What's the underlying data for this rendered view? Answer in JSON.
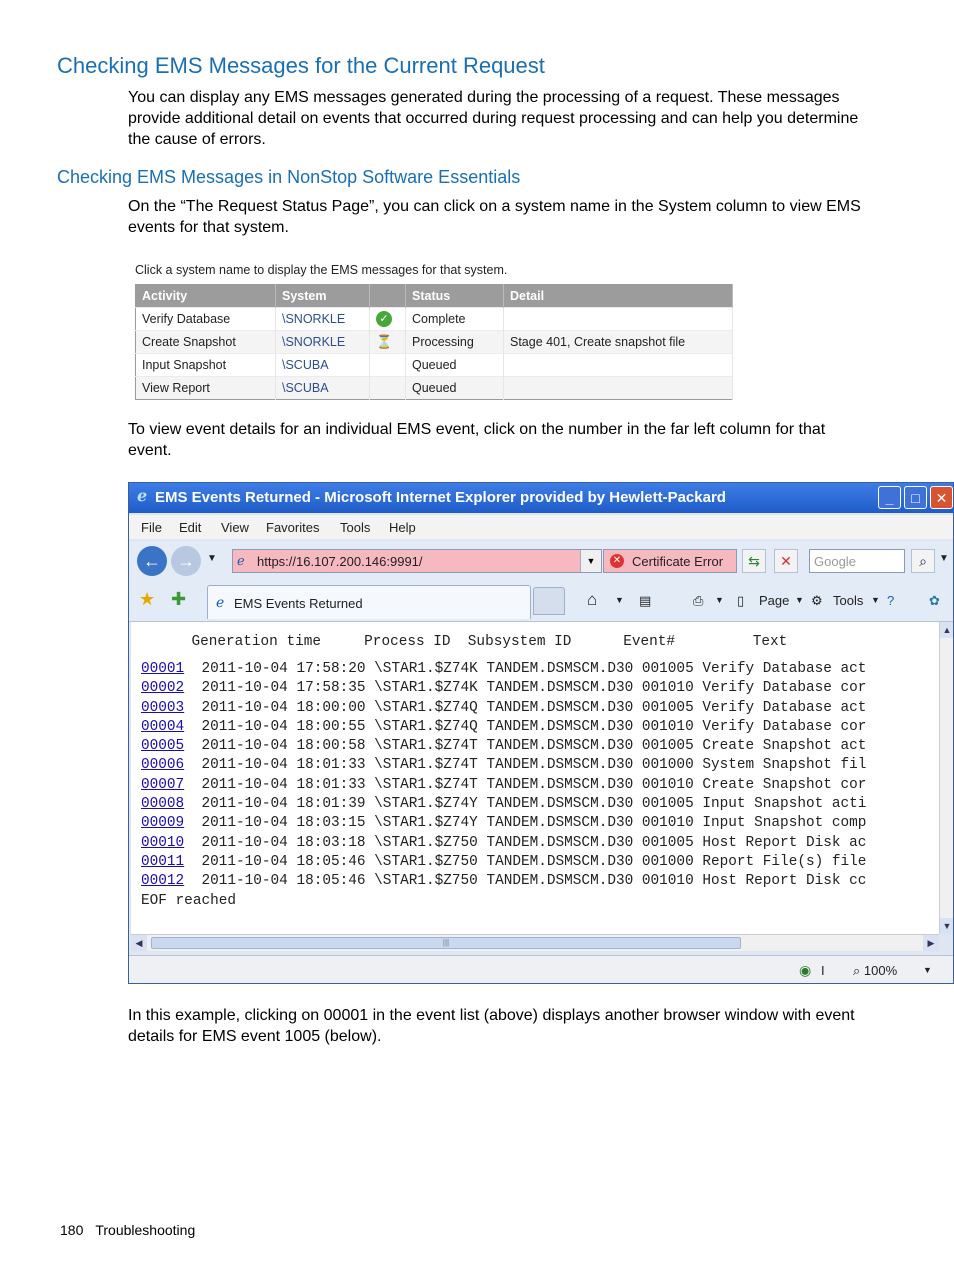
{
  "heading1": "Checking EMS Messages for the Current Request",
  "para1": "You can display any EMS messages generated during the processing of a request. These messages provide additional detail on events that occurred during request processing and can help you determine the cause of errors.",
  "heading2": "Checking EMS Messages in NonStop Software Essentials",
  "para2": "On the “The Request Status Page”, you can click on a system name in the System column to view EMS events for that system.",
  "fig1": {
    "caption": "Click a system name to display the EMS messages for that system.",
    "headers": [
      "Activity",
      "System",
      "",
      "Status",
      "Detail"
    ],
    "rows": [
      {
        "activity": "Verify Database",
        "system": "\\SNORKLE",
        "icon": "check-icon",
        "status": "Complete",
        "detail": ""
      },
      {
        "activity": "Create Snapshot",
        "system": "\\SNORKLE",
        "icon": "hourglass-icon",
        "status": "Processing",
        "detail": "Stage 401, Create snapshot file"
      },
      {
        "activity": "Input Snapshot",
        "system": "\\SCUBA",
        "icon": "",
        "status": "Queued",
        "detail": ""
      },
      {
        "activity": "View Report",
        "system": "\\SCUBA",
        "icon": "",
        "status": "Queued",
        "detail": ""
      }
    ]
  },
  "para3": "To view event details for an individual EMS event, click on the number in the far left column for that event.",
  "browser": {
    "title": "EMS Events Returned - Microsoft Internet Explorer provided by Hewlett-Packard",
    "menu": [
      "File",
      "Edit",
      "View",
      "Favorites",
      "Tools",
      "Help"
    ],
    "url": "https://16.107.200.146:9991/",
    "cert_error": "Certificate Error",
    "search_placeholder": "Google",
    "tab_title": "EMS Events Returned",
    "tools": {
      "page": "Page",
      "tools": "Tools"
    },
    "zoom": "100%",
    "status_zone": "I",
    "columns_header": "       Generation time     Process ID  Subsystem ID      Event#         Text",
    "events": [
      {
        "id": "00001",
        "rest": "  2011-10-04 17:58:20 \\STAR1.$Z74K TANDEM.DSMSCM.D30 001005 Verify Database act"
      },
      {
        "id": "00002",
        "rest": "  2011-10-04 17:58:35 \\STAR1.$Z74K TANDEM.DSMSCM.D30 001010 Verify Database cor"
      },
      {
        "id": "00003",
        "rest": "  2011-10-04 18:00:00 \\STAR1.$Z74Q TANDEM.DSMSCM.D30 001005 Verify Database act"
      },
      {
        "id": "00004",
        "rest": "  2011-10-04 18:00:55 \\STAR1.$Z74Q TANDEM.DSMSCM.D30 001010 Verify Database cor"
      },
      {
        "id": "00005",
        "rest": "  2011-10-04 18:00:58 \\STAR1.$Z74T TANDEM.DSMSCM.D30 001005 Create Snapshot act"
      },
      {
        "id": "00006",
        "rest": "  2011-10-04 18:01:33 \\STAR1.$Z74T TANDEM.DSMSCM.D30 001000 System Snapshot fil"
      },
      {
        "id": "00007",
        "rest": "  2011-10-04 18:01:33 \\STAR1.$Z74T TANDEM.DSMSCM.D30 001010 Create Snapshot cor"
      },
      {
        "id": "00008",
        "rest": "  2011-10-04 18:01:39 \\STAR1.$Z74Y TANDEM.DSMSCM.D30 001005 Input Snapshot acti"
      },
      {
        "id": "00009",
        "rest": "  2011-10-04 18:03:15 \\STAR1.$Z74Y TANDEM.DSMSCM.D30 001010 Input Snapshot comp"
      },
      {
        "id": "00010",
        "rest": "  2011-10-04 18:03:18 \\STAR1.$Z750 TANDEM.DSMSCM.D30 001005 Host Report Disk ac"
      },
      {
        "id": "00011",
        "rest": "  2011-10-04 18:05:46 \\STAR1.$Z750 TANDEM.DSMSCM.D30 001000 Report File(s) file"
      },
      {
        "id": "00012",
        "rest": "  2011-10-04 18:05:46 \\STAR1.$Z750 TANDEM.DSMSCM.D30 001010 Host Report Disk cc"
      }
    ],
    "eof": "EOF reached"
  },
  "para4": "In this example, clicking on 00001 in the event list (above) displays another browser window with event details for EMS event 1005 (below).",
  "footer": {
    "page_number": "180",
    "section": "Troubleshooting"
  }
}
